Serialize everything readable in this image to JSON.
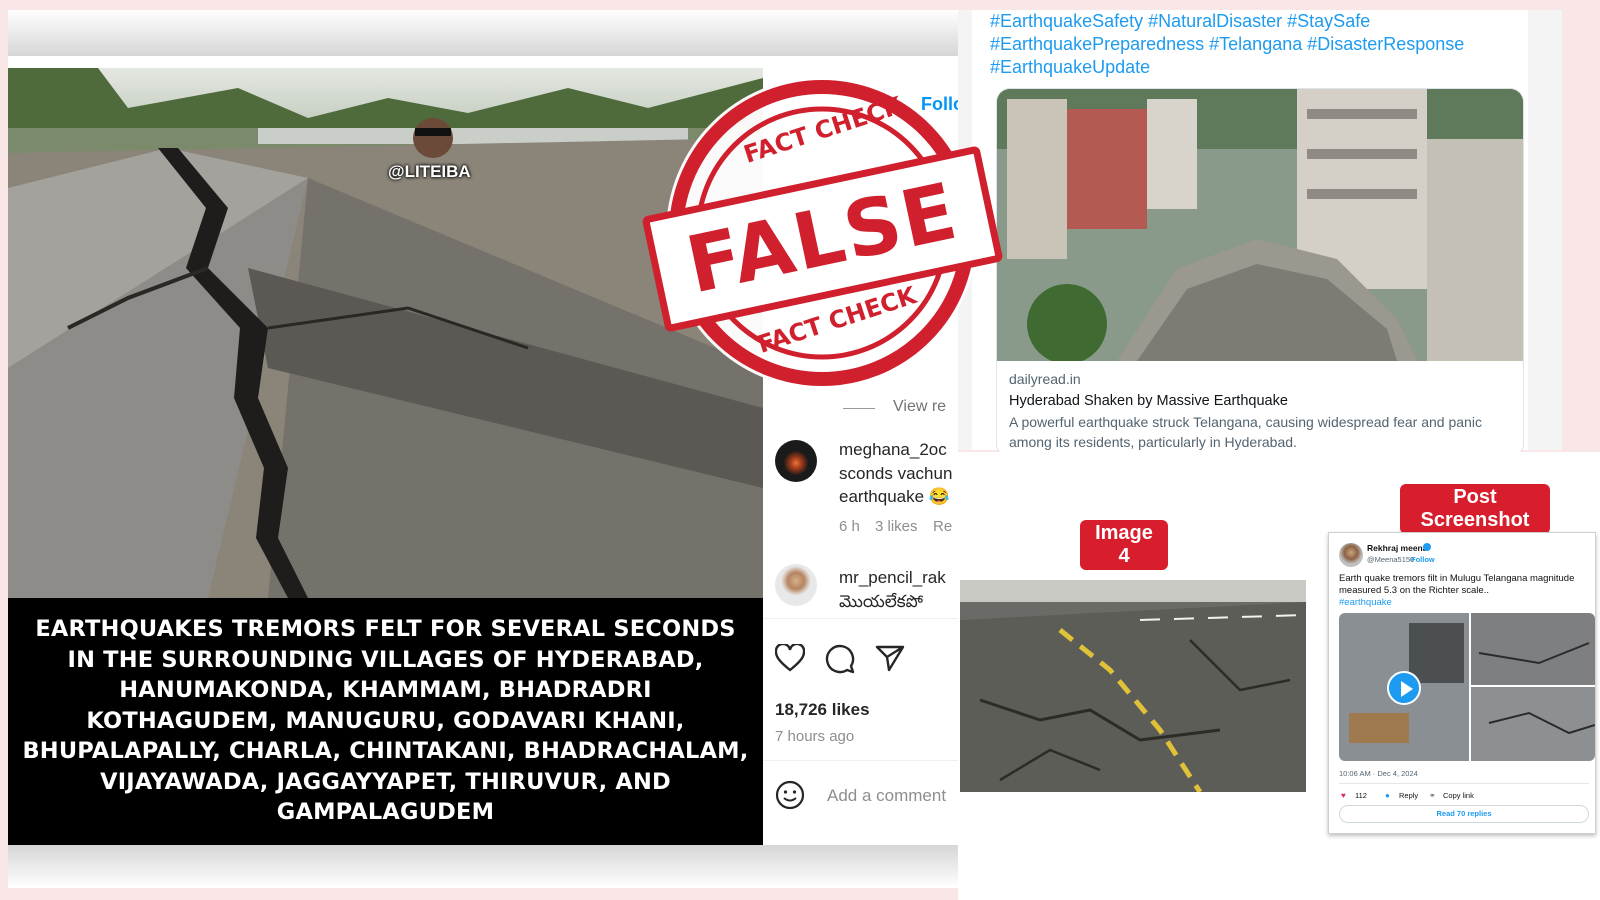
{
  "instagram_post": {
    "watermark": "@LITEIBA",
    "overlay_text": "EARTHQUAKES TREMORS FELT FOR SEVERAL SECONDS IN THE SURROUNDING VILLAGES OF HYDERABAD, HANUMAKONDA, KHAMMAM, BHADRADRI KOTHAGUDEM, MANUGURU, GODAVARI KHANI, BHUPALAPALLY, CHARLA, CHINTAKANI, BHADRACHALAM, VIJAYAWADA, JAGGAYYAPET, THIRUVUR, AND GAMPALAGUDEM",
    "overlay_lines": [
      "EARTHQUAKES TREMORS FELT FOR SEVERAL SECONDS",
      "IN THE SURROUNDING VILLAGES OF HYDERABAD,",
      "HANUMAKONDA, KHAMMAM, BHADRADRI",
      "KOTHAGUDEM, MANUGURU, GODAVARI KHANI,",
      "BHUPALAPALLY, CHARLA, CHINTAKANI, BHADRACHALAM,",
      "VIJAYAWADA, JAGGAYYAPET, THIRUVUR, AND",
      "GAMPALAGUDEM"
    ],
    "follow_partial": "Follo",
    "view_replies": "View re",
    "comments": [
      {
        "username": "meghana_2oc",
        "lines": [
          "sconds vachun",
          "earthquake 😂"
        ],
        "time": "6 h",
        "likes": "3 likes",
        "reply": "Re"
      },
      {
        "username": "mr_pencil_rak",
        "lines": [
          "మొయలేకపో"
        ],
        "time": "",
        "likes": "",
        "reply": ""
      }
    ],
    "likes": "18,726 likes",
    "posted": "7 hours ago",
    "add_comment_placeholder": "Add a comment"
  },
  "stamp": {
    "top_text": "FACT CHECK",
    "main_text": "FALSE",
    "bottom_text": "FACT CHECK",
    "color": "#d0202e"
  },
  "tweet_preview": {
    "hashtags_line1": "#EarthquakeSafety #NaturalDisaster #StaySafe",
    "hashtags_line2": "#EarthquakePreparedness #Telangana #DisasterResponse",
    "hashtags_line3": "#EarthquakeUpdate",
    "domain": "dailyread.in",
    "headline": "Hyderabad Shaken by Massive Earthquake",
    "description": "A powerful earthquake struck Telangana, causing widespread fear and panic",
    "description_cut": "among its residents, particularly in Hyderabad."
  },
  "evidence": {
    "image4_label": "Image 4",
    "post_screenshot_label": "Post Screenshot",
    "tweet": {
      "name": "Rekhraj meena",
      "handle": "@Meena5150",
      "follow": "Follow",
      "text": "Earth quake tremors filt in Mulugu Telangana magnitude measured 5.3 on the Richter scale..",
      "hashtag": "#earthquake",
      "timestamp": "10:06 AM · Dec 4, 2024",
      "likes": "112",
      "reply": "Reply",
      "copy_link": "Copy link",
      "read_replies": "Read 70 replies"
    }
  },
  "colors": {
    "accent_red": "#d81e2c",
    "link_blue": "#1d9bf0",
    "background_pink": "#f9e6e6"
  }
}
